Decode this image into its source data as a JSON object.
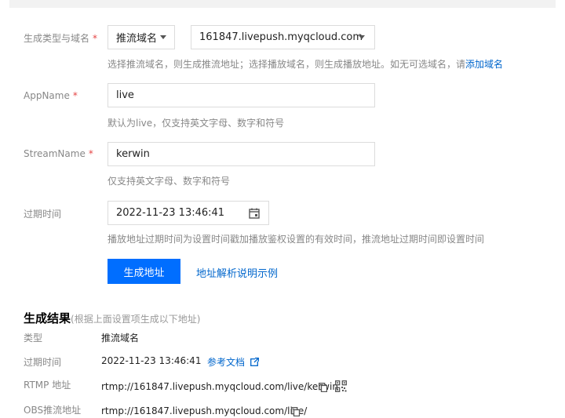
{
  "form": {
    "type_domain": {
      "label": "生成类型与域名",
      "required_mark": "*",
      "type_value": "推流域名",
      "domain_value": "161847.livepush.myqcloud.com",
      "hint_text": "选择推流域名，则生成推流地址；选择播放域名，则生成播放地址。如无可选域名，请",
      "hint_link": "添加域名"
    },
    "app_name": {
      "label": "AppName",
      "required_mark": "*",
      "value": "live",
      "hint": "默认为live，仅支持英文字母、数字和符号"
    },
    "stream_name": {
      "label": "StreamName",
      "required_mark": "*",
      "value": "kerwin",
      "hint": "仅支持英文字母、数字和符号"
    },
    "expire": {
      "label": "过期时间",
      "value": "2022-11-23 13:46:41",
      "hint": "播放地址过期时间为设置时间戳加播放鉴权设置的有效时间，推流地址过期时间即设置时间"
    },
    "generate_button": "生成地址",
    "example_link": "地址解析说明示例"
  },
  "result": {
    "title": "生成结果",
    "subtitle": "(根据上面设置项生成以下地址)",
    "rows": {
      "type": {
        "label": "类型",
        "value": "推流域名"
      },
      "expire": {
        "label": "过期时间",
        "value": "2022-11-23 13:46:41",
        "link": "参考文档"
      },
      "rtmp": {
        "label": "RTMP 地址",
        "value": "rtmp://161847.livepush.myqcloud.com/live/kerwin"
      },
      "obs": {
        "label": "OBS推流地址",
        "value": "rtmp://161847.livepush.myqcloud.com/live/"
      }
    }
  },
  "colors": {
    "primary": "#006eff",
    "link": "#0066cc",
    "required": "#e54545"
  },
  "icons": [
    "caret-down-icon",
    "calendar-icon",
    "external-link-icon",
    "copy-icon",
    "qrcode-icon"
  ]
}
